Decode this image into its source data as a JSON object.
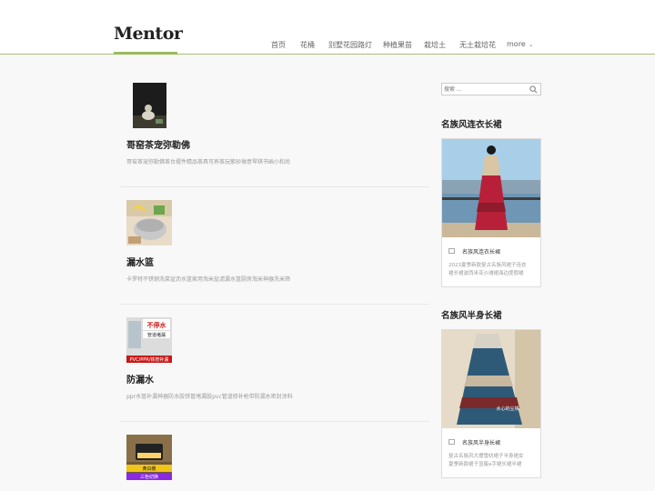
{
  "site": {
    "logo": "Mentor"
  },
  "nav": {
    "items": [
      "首页",
      "花桶",
      "别墅花园路灯",
      "种植果苗",
      "栽培土",
      "无土栽培花"
    ],
    "more": "more"
  },
  "posts": [
    {
      "title": "哥窑茶宠弥勒佛",
      "desc": "哥窑茶宠弥勒佛茶台摆件精品茶具可养茶玩紫砂禅意琴棋书画小和尚"
    },
    {
      "title": "漏水篮",
      "desc": "卡罗特不锈钢洗菜盆沥水篮家用淘米盆滤漏水篮厨房淘米神器洗米筛"
    },
    {
      "title": "防漏水",
      "desc": "ppr水管补漏神器防水胶铁管堵漏胶pvc管道修补枪带防漏水密封涂料",
      "thumb_text": [
        "不停水",
        "管道堵漏",
        "PVC/PPR/铁管补漏"
      ]
    },
    {
      "title": "",
      "desc": "",
      "thumb_text": [
        "黄白暖",
        "三色切换"
      ]
    }
  ],
  "sidebar": {
    "search_placeholder": "搜索 ...",
    "widgets": [
      {
        "title": "名族风连衣长裙",
        "caption": "名族风连衣长裙",
        "lines": [
          "2023夏季新款复古名族风裙子连衣",
          "裙长裙波西米亚沙滩裙海边度假裙"
        ]
      },
      {
        "title": "名族风半身长裙",
        "caption": "名族风半身长裙",
        "lines": [
          "复古名族风大摆雪纺裙子半身裙女",
          "夏季新款裙子显瘦a字裙长裙半裙"
        ],
        "img_text": "水心的尘埃"
      }
    ]
  },
  "colors": {
    "accent": "#9aba5a",
    "header_bg": "#ffffff",
    "page_bg": "#f8f8f8"
  }
}
